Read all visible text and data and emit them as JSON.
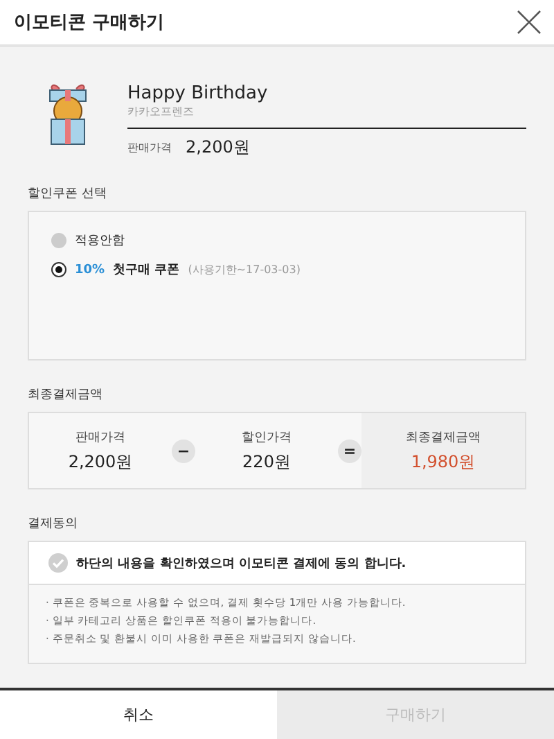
{
  "window": {
    "title": "이모티콘 구매하기"
  },
  "product": {
    "name": "Happy Birthday",
    "author": "카카오프렌즈",
    "price_label": "판매가격",
    "price": "2,200원"
  },
  "coupon_section": {
    "title": "할인쿠폰 선택",
    "options": [
      {
        "label": "적용안함",
        "selected": false
      },
      {
        "discount": "10%",
        "label": "첫구매 쿠폰",
        "expiry": "(사용기한~17-03-03)",
        "selected": true
      }
    ]
  },
  "summary_section": {
    "title": "최종결제금액",
    "items": [
      {
        "kind": "amount",
        "label": "판매가격",
        "value": "2,200원"
      },
      {
        "kind": "operator",
        "symbol": "−"
      },
      {
        "kind": "amount",
        "label": "할인가격",
        "value": "220원"
      },
      {
        "kind": "operator",
        "symbol": "="
      },
      {
        "kind": "total",
        "label": "최종결제금액",
        "value": "1,980원"
      }
    ]
  },
  "consent_section": {
    "title": "결제동의",
    "agree": {
      "label": "하단의 내용을 확인하였으며 이모티콘 결제에 동의 합니다.",
      "checked": false
    },
    "notes": [
      "· 쿠폰은 중복으로 사용할 수 없으며, 결제 횟수당 1개만 사용 가능합니다.",
      "· 일부 카테고리 상품은 할인쿠폰 적용이 불가능합니다.",
      "· 주문취소 및 환불시 이미 사용한 쿠폰은 재발급되지 않습니다."
    ]
  },
  "footer": {
    "cancel": {
      "label": "취소"
    },
    "buy": {
      "label": "구매하기",
      "disabled": true
    }
  }
}
